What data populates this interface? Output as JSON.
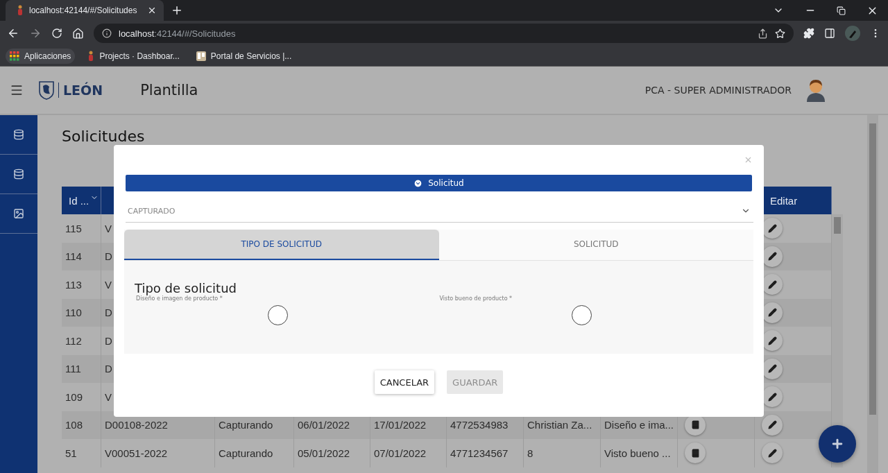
{
  "browser": {
    "tab_title": "localhost:42144/#/Solicitudes",
    "url_host": "localhost",
    "url_path": ":42144/#/Solicitudes",
    "bookmarks": [
      {
        "label": "Aplicaciones",
        "kind": "apps"
      },
      {
        "label": "Projects · Dashboar...",
        "kind": "site"
      },
      {
        "label": "Portal de Servicios |...",
        "kind": "portal"
      }
    ]
  },
  "header": {
    "logo_text": "LEÓN",
    "app_title": "Plantilla",
    "user": "PCA - SUPER ADMINISTRADOR"
  },
  "sidebar": {
    "items": [
      {
        "kind": "database"
      },
      {
        "kind": "database"
      },
      {
        "kind": "image"
      }
    ]
  },
  "page_title": "Solicitudes",
  "table": {
    "columns": [
      {
        "label": "Id ..."
      },
      {
        "label": "Editar"
      }
    ],
    "rows": [
      {
        "cells": [
          "115",
          "V"
        ]
      },
      {
        "cells": [
          "114",
          "D"
        ]
      },
      {
        "cells": [
          "113",
          "V"
        ]
      },
      {
        "cells": [
          "110",
          "D"
        ]
      },
      {
        "cells": [
          "112",
          "D"
        ]
      },
      {
        "cells": [
          "111",
          "D"
        ]
      },
      {
        "cells": [
          "109",
          "V"
        ]
      },
      {
        "cells": [
          "108",
          "D00108-2022",
          "Capturando",
          "06/01/2022",
          "17/01/2022",
          "4772534983",
          "Christian Za...",
          "Diseño e ima..."
        ]
      },
      {
        "cells": [
          "51",
          "V00051-2022",
          "Capturando",
          "05/01/2022",
          "07/01/2022",
          "4771234567",
          "8",
          "Visto bueno ..."
        ]
      }
    ]
  },
  "modal": {
    "banner": "Solicitud",
    "status": "CAPTURADO",
    "tabs": [
      {
        "label": "TIPO DE SOLICITUD",
        "selected": true
      },
      {
        "label": "SOLICITUD",
        "selected": false
      }
    ],
    "section_title": "Tipo de solicitud",
    "options": [
      {
        "label": "Diseño e imagen de producto *",
        "selected": false
      },
      {
        "label": "Visto bueno de producto *",
        "selected": false
      }
    ],
    "buttons": [
      {
        "label": "CANCELAR",
        "disabled": false
      },
      {
        "label": "GUARDAR",
        "disabled": true
      }
    ]
  }
}
